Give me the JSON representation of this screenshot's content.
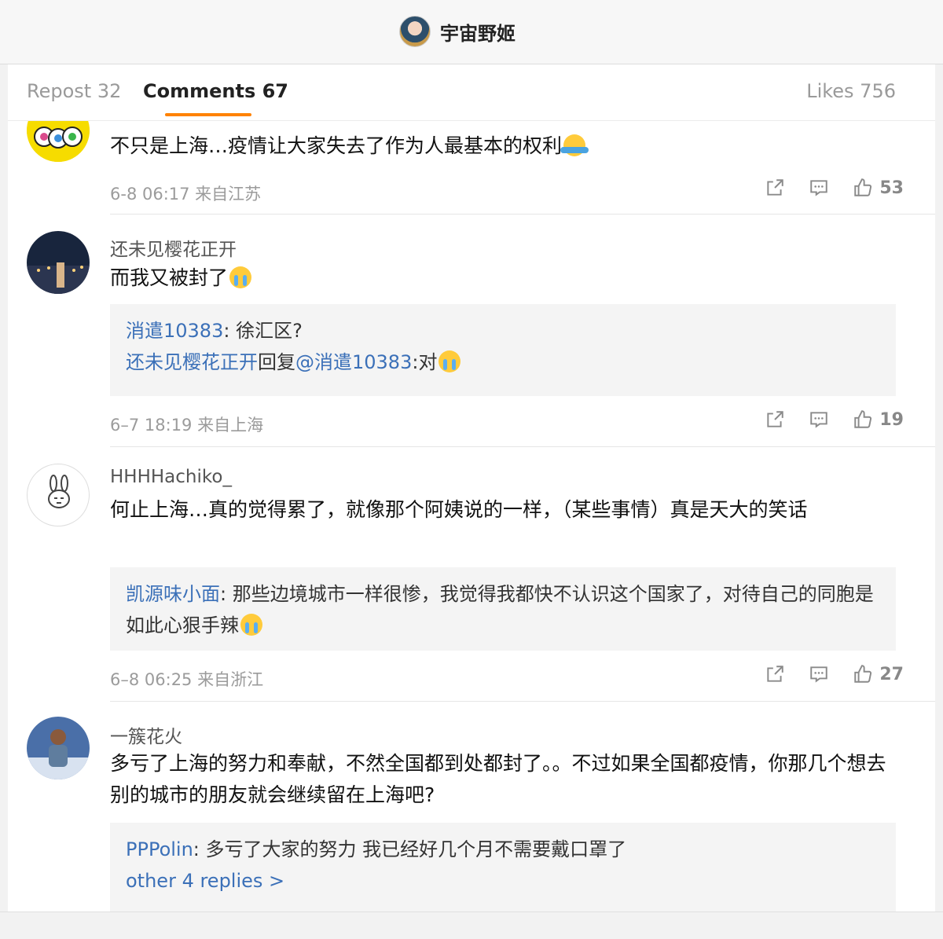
{
  "header": {
    "title": "宇宙野姬"
  },
  "tabs": {
    "repost": "Repost 32",
    "comments": "Comments 67",
    "likes": "Likes 756"
  },
  "comments": [
    {
      "text": "不只是上海…疫情让大家失去了作为人最基本的权利",
      "time": "6-8 06:17 来自江苏",
      "likes": "53"
    },
    {
      "user": "还未见樱花正开",
      "text": "而我又被封了",
      "reply1_user": "消遣10383",
      "reply1_text": ": 徐汇区?",
      "reply2_user": "还未见樱花正开",
      "reply2_mid": "回复",
      "reply2_at": "@消遣10383",
      "reply2_text": ":对",
      "time": "6–7 18:19 来自上海",
      "likes": "19"
    },
    {
      "user": "HHHHachiko_",
      "text": "何止上海…真的觉得累了，就像那个阿姨说的一样，（某些事情）真是天大的笑话",
      "reply1_user": "凯源味小面",
      "reply1_text": ": 那些边境城市一样很惨，我觉得我都快不认识这个国家了，对待自己的同胞是如此心狠手辣",
      "time": "6–8 06:25 来自浙江",
      "likes": "27"
    },
    {
      "user": "一簇花火",
      "text": "多亏了上海的努力和奉献，不然全国都到处都封了。。不过如果全国都疫情，你那几个想去别的城市的朋友就会继续留在上海吧?",
      "reply1_user": "PPPolin",
      "reply1_text": ": 多亏了大家的努力 我已经好几个月不需要戴口罩了",
      "more": "other 4 replies >"
    }
  ]
}
